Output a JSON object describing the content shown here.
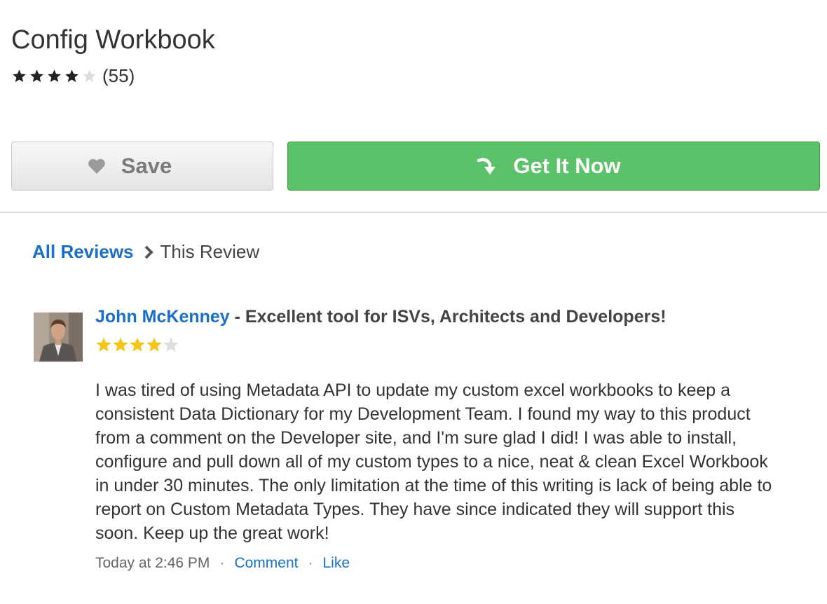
{
  "app": {
    "title": "Config Workbook",
    "rating": 4,
    "rating_max": 5,
    "review_count": "(55)"
  },
  "actions": {
    "save_label": "Save",
    "get_label": "Get It Now"
  },
  "breadcrumb": {
    "all_reviews": "All Reviews",
    "current": "This Review"
  },
  "review": {
    "reviewer": "John McKenney",
    "separator": " - ",
    "title": "Excellent tool for ISVs, Architects and Developers!",
    "rating": 4,
    "rating_max": 5,
    "body": "I was tired of using Metadata API to update my custom excel workbooks to keep a consistent Data Dictionary for my Development Team. I found my way to this product from a comment on the Developer site, and I'm sure glad I did! I was able to install, configure and pull down all of my custom types to a nice, neat & clean Excel Workbook in under 30 minutes. The only limitation at the time of this writing is lack of being able to report on Custom Metadata Types. They have since indicated they will support this soon. Keep up the great work!",
    "time": "Today at 2:46 PM",
    "dot": "·",
    "comment_label": "Comment",
    "like_label": "Like"
  },
  "colors": {
    "link_blue": "#1a6fc5",
    "get_green": "#5cc269",
    "star_dark": "#222222",
    "star_gold": "#f5c518",
    "star_empty": "#dddddd"
  },
  "icons": {
    "save": "heart-icon",
    "get": "curved-arrow-icon",
    "breadcrumb": "chevron-right-icon",
    "rating": "star-icon"
  }
}
